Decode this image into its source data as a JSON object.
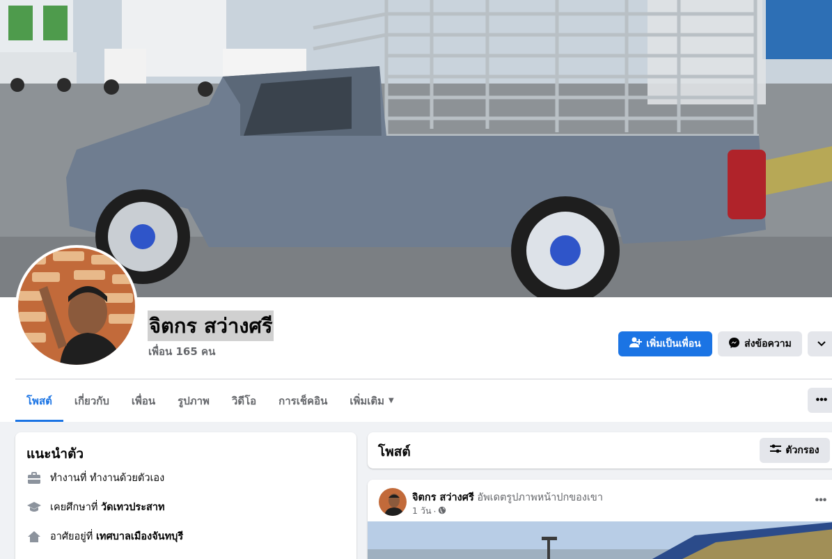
{
  "profile": {
    "name": "จิตกร สว่างศรี",
    "friends": "เพื่อน 165 คน"
  },
  "actions": {
    "add_friend": "เพิ่มเป็นเพื่อน",
    "message": "ส่งข้อความ"
  },
  "tabs": [
    {
      "label": "โพสต์",
      "active": true
    },
    {
      "label": "เกี่ยวกับ",
      "active": false
    },
    {
      "label": "เพื่อน",
      "active": false
    },
    {
      "label": "รูปภาพ",
      "active": false
    },
    {
      "label": "วิดีโอ",
      "active": false
    },
    {
      "label": "การเช็คอิน",
      "active": false
    },
    {
      "label": "เพิ่มเติม",
      "active": false
    }
  ],
  "intro": {
    "title": "แนะนำตัว",
    "items": [
      {
        "icon": "briefcase-icon",
        "prefix": "ทำงานที่",
        "value": "ทำงานด้วยตัวเอง",
        "value_bold": false
      },
      {
        "icon": "graduation-cap-icon",
        "prefix": "เคยศึกษาที่",
        "value": "วัดเทวประสาท",
        "value_bold": true
      },
      {
        "icon": "home-icon",
        "prefix": "อาศัยอยู่ที่",
        "value": "เทศบาลเมืองจันทบุรี",
        "value_bold": true
      }
    ]
  },
  "posts": {
    "title": "โพสต์",
    "filter_label": "ตัวกรอง"
  },
  "post": {
    "author": "จิตกร สว่างศรี",
    "activity": "อัพเดตรูปภาพหน้าปกของเขา",
    "time": "1 วัน",
    "privacy_icon": "globe-icon"
  },
  "colors": {
    "accent": "#1b74e4",
    "secondary_button": "#e4e6eb",
    "background": "#f0f2f5"
  }
}
